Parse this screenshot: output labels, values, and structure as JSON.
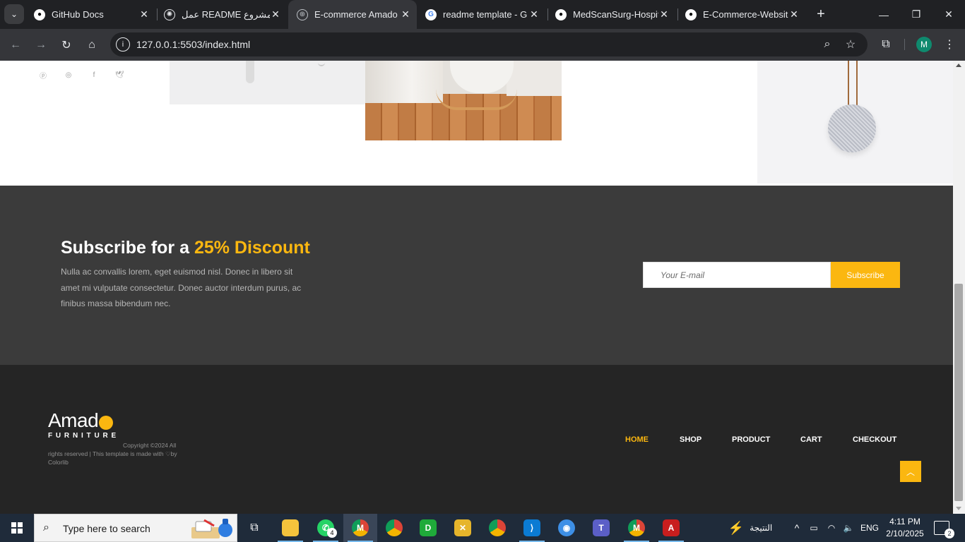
{
  "browser": {
    "tabs": [
      {
        "title": "GitHub Docs",
        "favicon": "github-icon",
        "active": false
      },
      {
        "title": "عمل README لمشروع",
        "favicon": "chatgpt-icon",
        "active": false
      },
      {
        "title": "E-commerce Amado",
        "favicon": "globe-icon",
        "active": true
      },
      {
        "title": "readme template - G",
        "favicon": "google-icon",
        "active": false
      },
      {
        "title": "MedScanSurg-Hospit",
        "favicon": "github-icon",
        "active": false
      },
      {
        "title": "E-Commerce-Website",
        "favicon": "github-icon",
        "active": false
      }
    ],
    "address": "127.0.0.1:5503/index.html",
    "profile_initial": "M",
    "accent": "#35363a"
  },
  "gallery": {
    "socials": [
      "pinterest-icon",
      "instagram-icon",
      "facebook-icon",
      "twitter-icon"
    ]
  },
  "subscribe": {
    "title_prefix": "Subscribe for a ",
    "title_accent": "25% Discount",
    "description": "Nulla ac convallis lorem, eget euismod nisl. Donec in libero sit amet mi vulputate consectetur. Donec auctor interdum purus, ac finibus massa bibendum nec.",
    "email_placeholder": "Your E-mail",
    "button_label": "Subscribe",
    "accent_color": "#fbb710"
  },
  "footer": {
    "logo_text": "Amad",
    "logo_subtitle": "FURNITURE",
    "copyright_line1": "Copyright ©2024 All",
    "copyright_line2": "rights reserved | This template is made with ♡by",
    "copyright_line3": "Colorlib",
    "nav": [
      "HOME",
      "SHOP",
      "PRODUCT",
      "CART",
      "CHECKOUT"
    ],
    "active_nav": "HOME"
  },
  "taskbar": {
    "search_placeholder": "Type here to search",
    "whatsapp_badge": "4",
    "weather_text": "النتيجة",
    "language": "ENG",
    "time": "4:11 PM",
    "date": "2/10/2025",
    "notification_count": "2"
  }
}
